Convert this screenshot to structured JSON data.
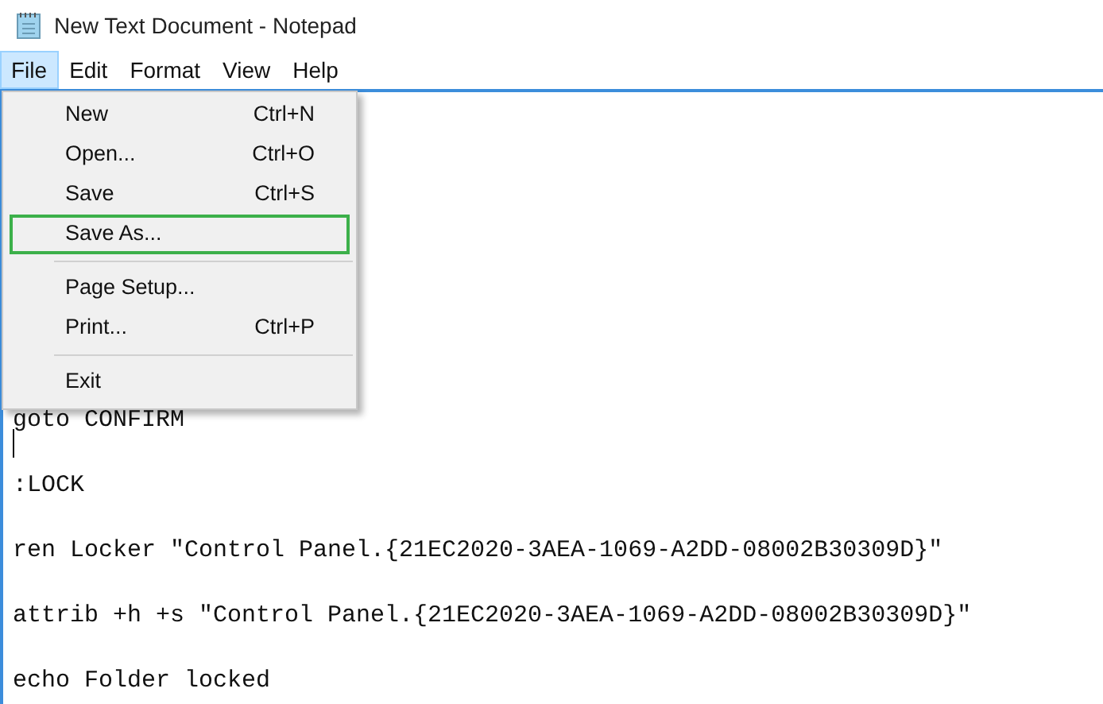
{
  "window": {
    "title": "New Text Document - Notepad"
  },
  "menubar": [
    {
      "label": "File",
      "selected": true
    },
    {
      "label": "Edit",
      "selected": false
    },
    {
      "label": "Format",
      "selected": false
    },
    {
      "label": "View",
      "selected": false
    },
    {
      "label": "Help",
      "selected": false
    }
  ],
  "file_menu": [
    {
      "kind": "item",
      "label": "New",
      "shortcut": "Ctrl+N",
      "selected": false
    },
    {
      "kind": "item",
      "label": "Open...",
      "shortcut": "Ctrl+O",
      "selected": false
    },
    {
      "kind": "item",
      "label": "Save",
      "shortcut": "Ctrl+S",
      "selected": false
    },
    {
      "kind": "item",
      "label": "Save As...",
      "selected": true
    },
    {
      "kind": "separator"
    },
    {
      "kind": "item",
      "label": "Page Setup...",
      "selected": false
    },
    {
      "kind": "item",
      "label": "Print...",
      "shortcut": "Ctrl+P",
      "selected": false
    },
    {
      "kind": "separator"
    },
    {
      "kind": "item",
      "label": "Exit",
      "selected": false
    }
  ],
  "editor": {
    "lines": [
      {
        "text": "goto CONFIRM",
        "caret_below": true
      },
      {
        "text": ":LOCK",
        "caret_below": false
      },
      {
        "text": "ren Locker \"Control Panel.{21EC2020-3AEA-1069-A2DD-08002B30309D}\"",
        "caret_below": false
      },
      {
        "text": "attrib +h +s \"Control Panel.{21EC2020-3AEA-1069-A2DD-08002B30309D}\"",
        "caret_below": false
      },
      {
        "text": "echo Folder locked",
        "caret_below": false
      }
    ]
  }
}
